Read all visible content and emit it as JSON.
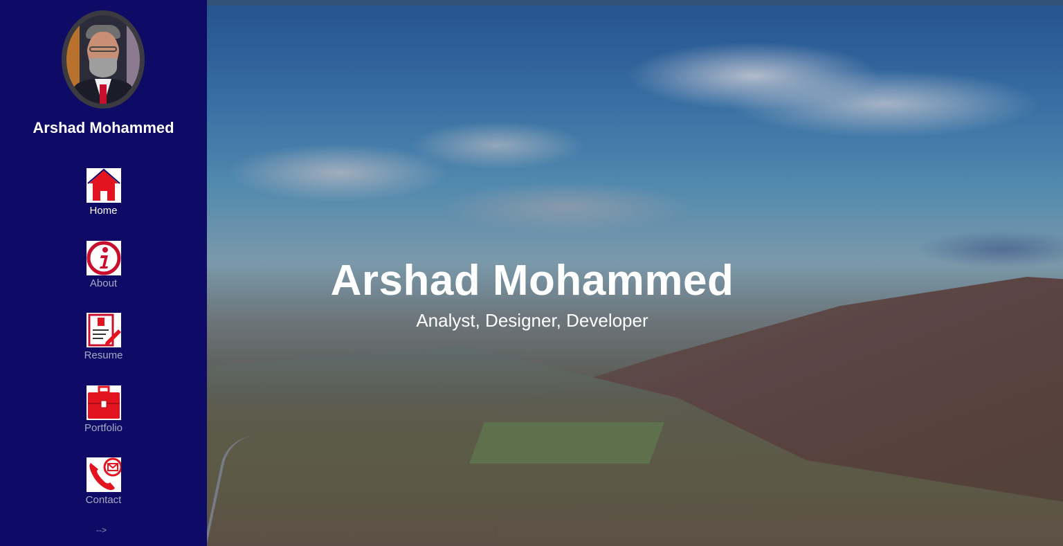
{
  "sidebar": {
    "name": "Arshad Mohammed",
    "items": [
      {
        "label": "Home",
        "icon": "home-icon"
      },
      {
        "label": "About",
        "icon": "info-icon"
      },
      {
        "label": "Resume",
        "icon": "resume-icon"
      },
      {
        "label": "Portfolio",
        "icon": "briefcase-icon"
      },
      {
        "label": "Contact",
        "icon": "phone-mail-icon"
      }
    ],
    "active_item": "Home",
    "comment_tail": "-->"
  },
  "hero": {
    "title": "Arshad Mohammed",
    "subtitle": "Analyst, Designer, Developer"
  },
  "colors": {
    "sidebar_bg": "#0e0b66",
    "icon_red": "#e3141f",
    "text_white": "#ffffff",
    "nav_muted": "#a9a9c4"
  }
}
